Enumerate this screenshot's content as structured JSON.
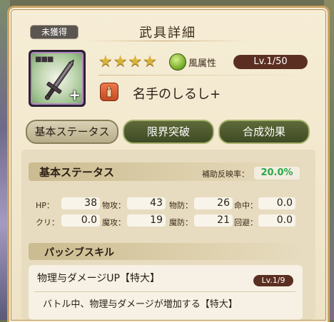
{
  "header": {
    "badge": "未獲得",
    "title": "武具詳細"
  },
  "weapon": {
    "icon": "sword-icon",
    "frame_dots": "■■■",
    "plus_symbol": "+",
    "stars": "★★★★",
    "attribute": "風属性",
    "level": "Lv.1/50",
    "skill": "名手のしるし+"
  },
  "tabs": [
    {
      "label": "基本ステータス",
      "active": true
    },
    {
      "label": "限界突破",
      "active": false
    },
    {
      "label": "合成効果",
      "active": false
    }
  ],
  "basic_stats": {
    "heading": "基本ステータス",
    "reflect_label": "補助反映率：",
    "reflect_value": "20.0%",
    "rows": [
      [
        {
          "label": "HP：",
          "value": "38"
        },
        {
          "label": "物攻：",
          "value": "43"
        },
        {
          "label": "物防：",
          "value": "26"
        },
        {
          "label": "命中：",
          "value": "0.0"
        }
      ],
      [
        {
          "label": "クリ：",
          "value": "0.0"
        },
        {
          "label": "魔攻：",
          "value": "19"
        },
        {
          "label": "魔防：",
          "value": "21"
        },
        {
          "label": "回避：",
          "value": "0.0"
        }
      ]
    ]
  },
  "passive": {
    "heading": "パッシブスキル",
    "title": "物理与ダメージUP【特大】",
    "level": "Lv.1/9",
    "description": "バトル中、物理与ダメージが増加する【特大】"
  },
  "colors": {
    "panel": "#f6edd6",
    "gold_border": "#c9a465",
    "level_badge": "#5a2f22",
    "reflect_green": "#2aa84a",
    "tab_green": "#4e5a30"
  }
}
